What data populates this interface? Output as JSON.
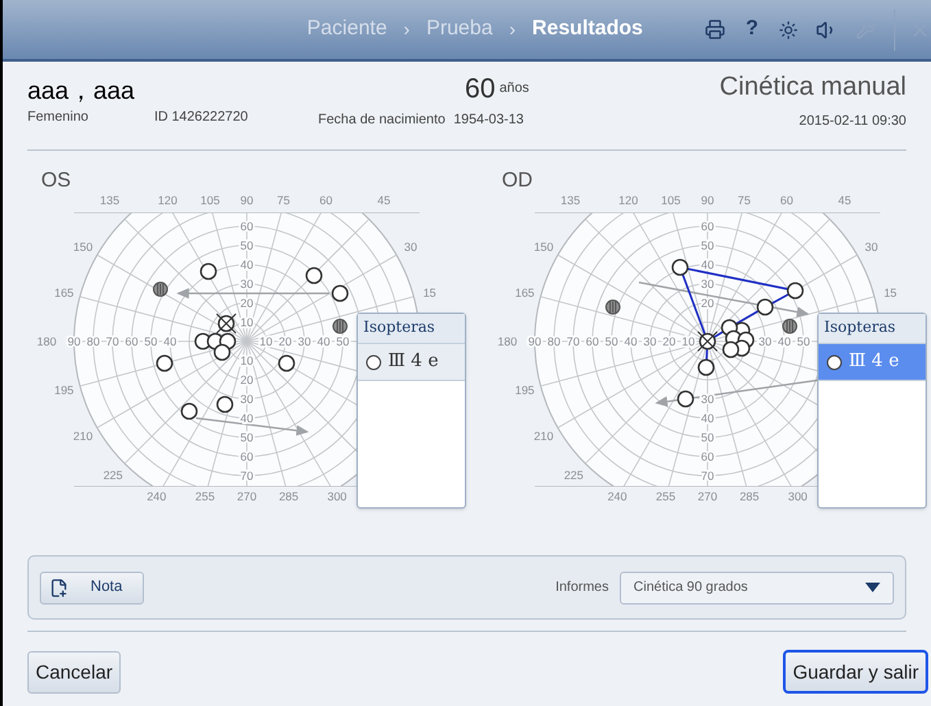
{
  "breadcrumbs": [
    {
      "label": "Paciente",
      "selected": false
    },
    {
      "label": "Prueba",
      "selected": false
    },
    {
      "label": "Resultados",
      "selected": true
    }
  ],
  "breadcrumb_separator": "›",
  "toolbar": {
    "help": "?"
  },
  "patient": {
    "name": "aaa，aaa",
    "sex": "Femenino",
    "id": "ID 1426222720",
    "birth_label": "Fecha de nacimiento",
    "birth_date": "1954-03-13",
    "age": "60",
    "age_unit": "años"
  },
  "test": {
    "title": "Cinética manual",
    "datetime": "2015-02-11 09:30"
  },
  "eyes": [
    {
      "label": "OS",
      "kind": "os",
      "angle_labels": [
        "135",
        "120",
        "105",
        "90",
        "75",
        "60",
        "45",
        "150",
        "30",
        "165",
        "15",
        "180",
        "195",
        "210",
        "225",
        "240",
        "255",
        "270",
        "285",
        "300"
      ],
      "horizontal_labels": [
        "90",
        "80",
        "70",
        "60",
        "50",
        "40",
        "10",
        "20",
        "30",
        "40",
        "50"
      ],
      "vertical_labels": [
        "60",
        "50",
        "40",
        "30",
        "20",
        "10",
        "10",
        "20",
        "30",
        "40",
        "50",
        "60",
        "70"
      ],
      "isopteras": {
        "title": "Isopteras",
        "items": [
          {
            "label": "Ⅲ 4 e",
            "selected": false
          }
        ]
      }
    },
    {
      "label": "OD",
      "kind": "od",
      "angle_labels": [
        "135",
        "120",
        "105",
        "90",
        "75",
        "60",
        "45",
        "150",
        "30",
        "165",
        "15",
        "180",
        "195",
        "210",
        "225",
        "240",
        "255",
        "270",
        "285",
        "300"
      ],
      "horizontal_labels": [
        "90",
        "80",
        "70",
        "60",
        "50",
        "40",
        "30",
        "20",
        "10",
        "30",
        "40",
        "50"
      ],
      "vertical_labels": [
        "60",
        "50",
        "40",
        "30",
        "20",
        "30",
        "40",
        "50",
        "60",
        "70"
      ],
      "isopteras": {
        "title": "Isopteras",
        "items": [
          {
            "label": "Ⅲ 4 e",
            "selected": true
          }
        ]
      }
    }
  ],
  "note_button": "Nota",
  "reports": {
    "label": "Informes",
    "value": "Cinética 90 grados"
  },
  "buttons": {
    "cancel": "Cancelar",
    "save": "Guardar y salir"
  }
}
